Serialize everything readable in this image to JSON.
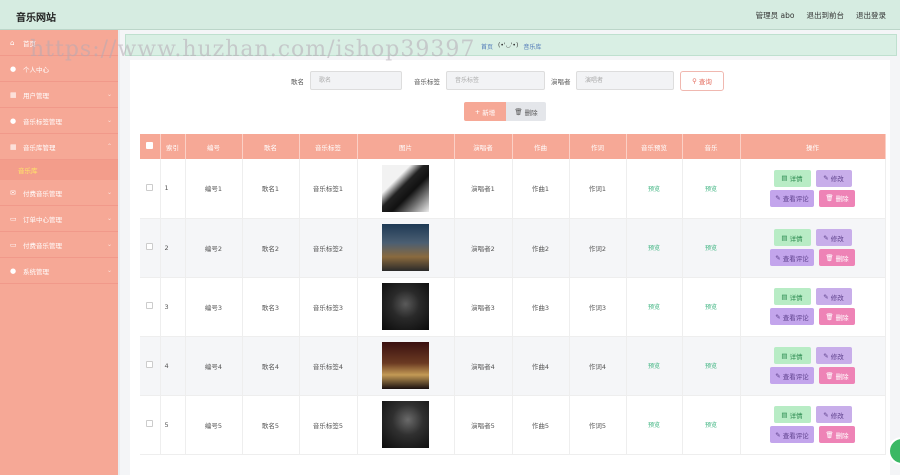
{
  "header": {
    "brand": "音乐网站",
    "user": "管理员 abo",
    "to_front": "退出到前台",
    "logout": "退出登录"
  },
  "sidebar": {
    "items": [
      {
        "label": "首页",
        "icon": "home-icon"
      },
      {
        "label": "个人中心",
        "icon": "user-icon"
      },
      {
        "label": "用户管理",
        "icon": "grid-icon"
      },
      {
        "label": "音乐标签管理",
        "icon": "user-icon"
      },
      {
        "label": "音乐库管理",
        "icon": "grid-icon"
      },
      {
        "label": "付费音乐管理",
        "icon": "mail-icon"
      },
      {
        "label": "订单中心管理",
        "icon": "card-icon"
      },
      {
        "label": "付费音乐管理",
        "icon": "card-icon"
      },
      {
        "label": "系统管理",
        "icon": "user-icon"
      }
    ],
    "active_sub": "音乐库"
  },
  "breadcrumb": {
    "home": "首页",
    "face": "(•'◡'•)",
    "current": "音乐库"
  },
  "search": {
    "song_label": "歌名",
    "song_placeholder": "歌名",
    "tag_label": "音乐标签",
    "tag_placeholder": "音乐标签",
    "singer_label": "演唱者",
    "singer_placeholder": "演唱者",
    "query": "查询"
  },
  "actions": {
    "add": "新增",
    "delete": "删除"
  },
  "table": {
    "headers": [
      "索引",
      "编号",
      "歌名",
      "音乐标签",
      "图片",
      "演唱者",
      "作曲",
      "作词",
      "音乐预览",
      "音乐",
      "操作"
    ],
    "preview_text": "预览",
    "music_text": "预览",
    "ops": {
      "detail": "详情",
      "edit": "修改",
      "comment": "查看评论",
      "remove": "删除"
    },
    "rows": [
      {
        "idx": "1",
        "code": "编号1",
        "song": "歌名1",
        "tag": "音乐标签1",
        "singer": "演唱者1",
        "composer": "作曲1",
        "lyricist": "作词1"
      },
      {
        "idx": "2",
        "code": "编号2",
        "song": "歌名2",
        "tag": "音乐标签2",
        "singer": "演唱者2",
        "composer": "作曲2",
        "lyricist": "作词2"
      },
      {
        "idx": "3",
        "code": "编号3",
        "song": "歌名3",
        "tag": "音乐标签3",
        "singer": "演唱者3",
        "composer": "作曲3",
        "lyricist": "作词3"
      },
      {
        "idx": "4",
        "code": "编号4",
        "song": "歌名4",
        "tag": "音乐标签4",
        "singer": "演唱者4",
        "composer": "作曲4",
        "lyricist": "作词4"
      },
      {
        "idx": "5",
        "code": "编号5",
        "song": "歌名5",
        "tag": "音乐标签5",
        "singer": "演唱者5",
        "composer": "作曲5",
        "lyricist": "作词5"
      }
    ]
  },
  "watermark": "https://www.huzhan.com/ishop39397"
}
